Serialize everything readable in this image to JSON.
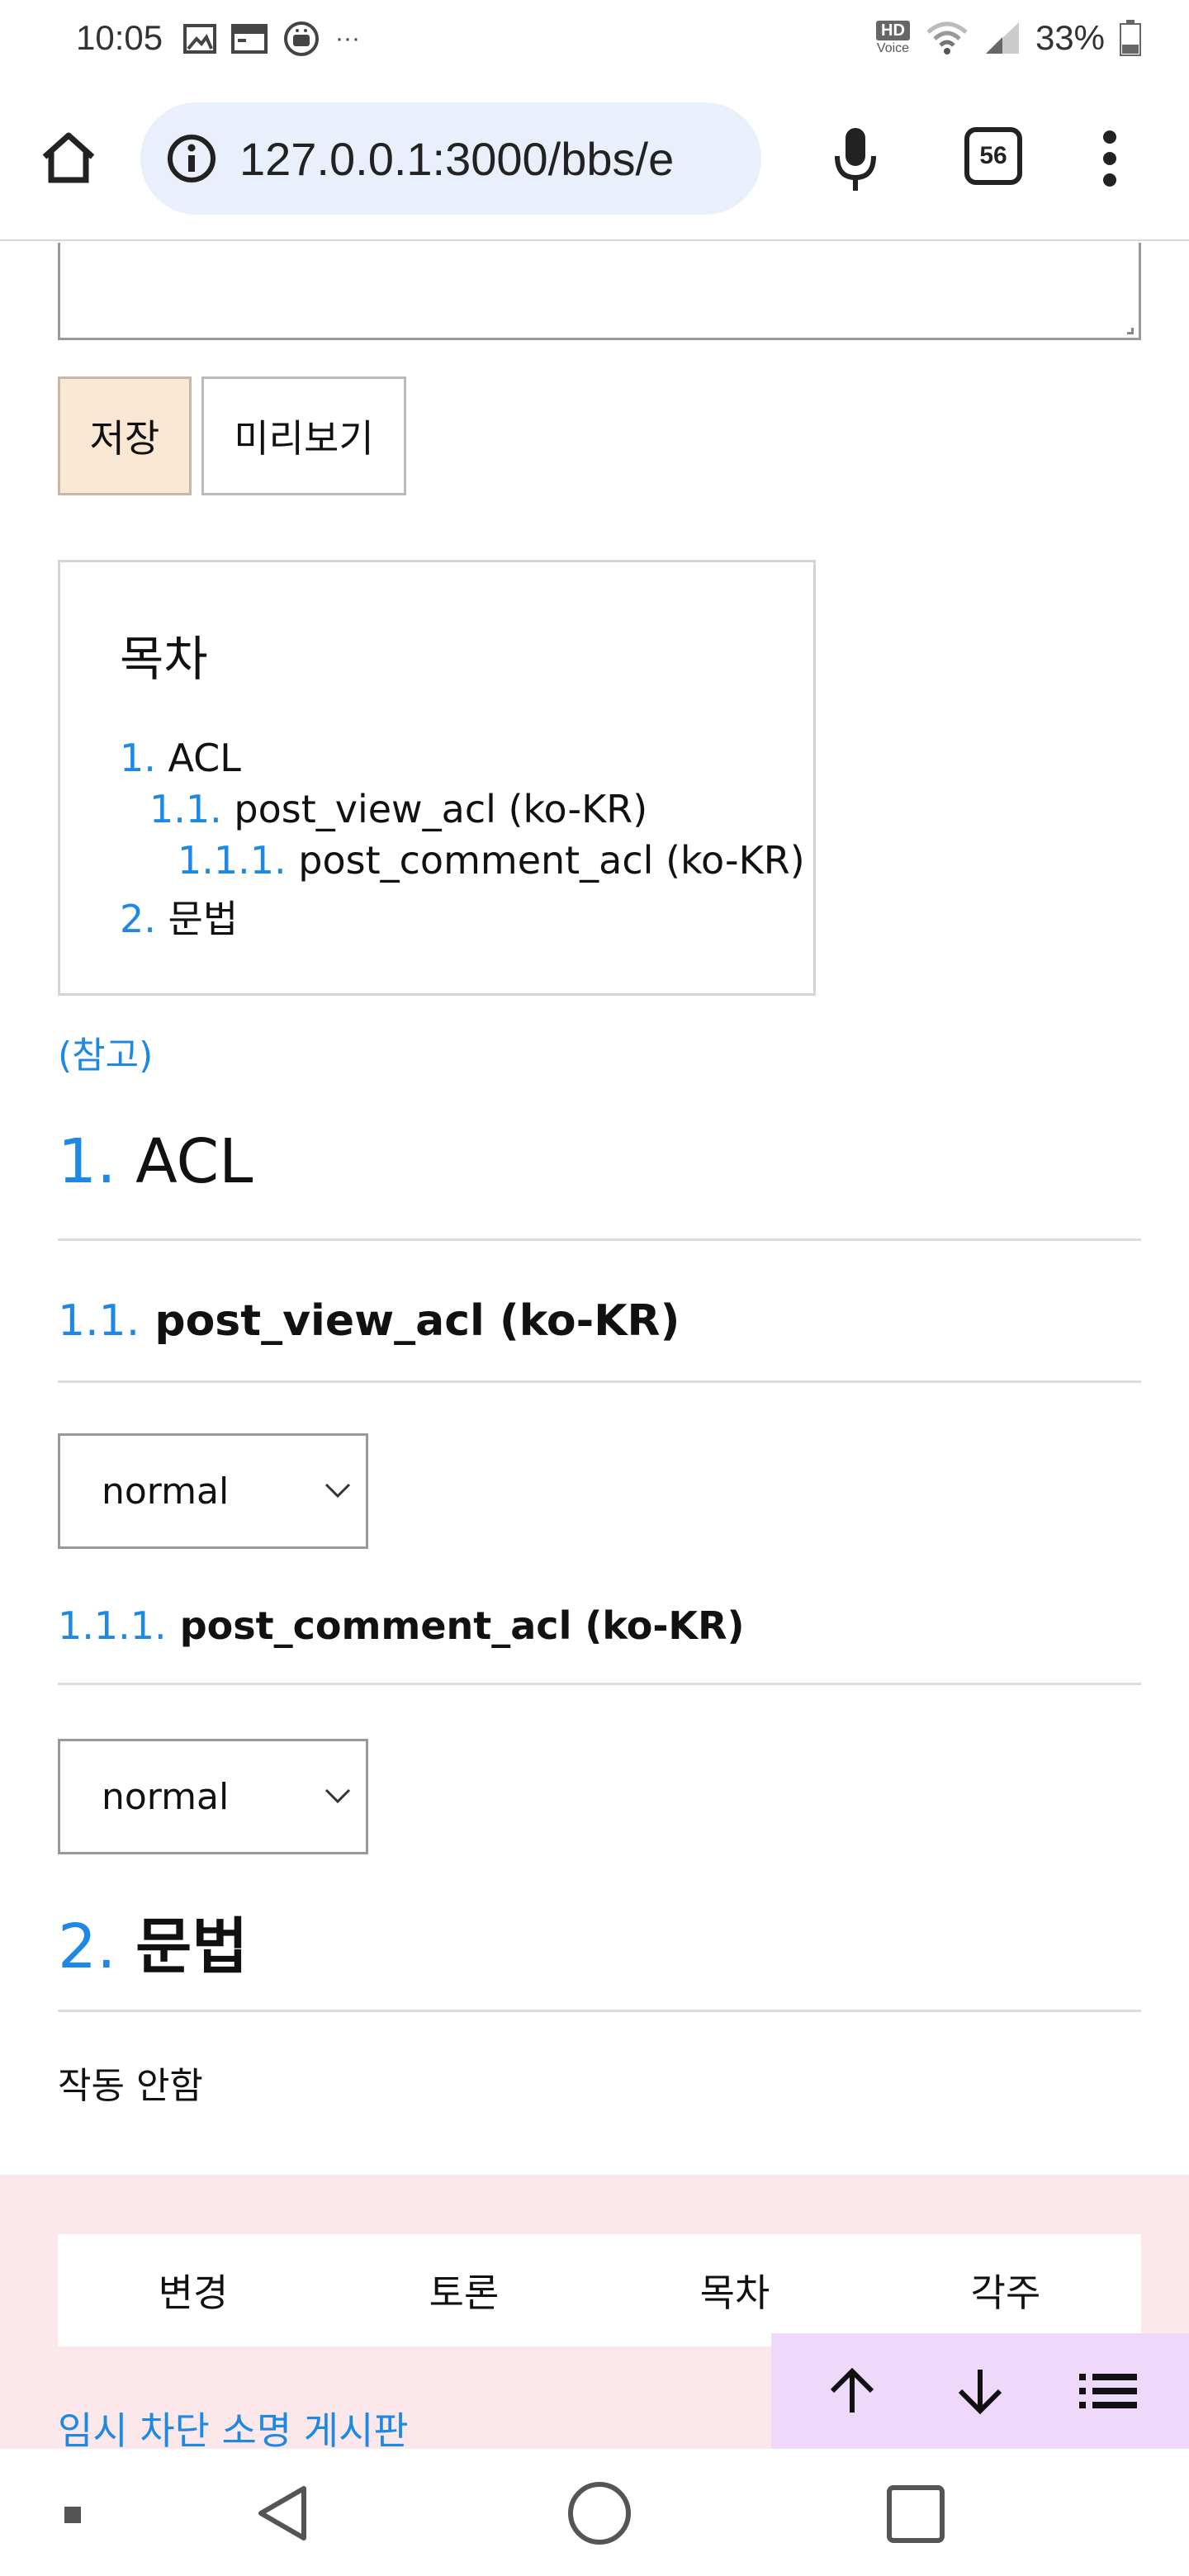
{
  "status_bar": {
    "time": "10:05",
    "more": "···",
    "hd_label": "HD",
    "voice_label": "Voice",
    "battery": "33%"
  },
  "toolbar": {
    "url": "127.0.0.1:3000/bbs/e",
    "tab_count": "56"
  },
  "editor": {
    "save_label": "저장",
    "preview_label": "미리보기"
  },
  "toc": {
    "title": "목차",
    "items": [
      {
        "num": "1.",
        "label": "ACL"
      },
      {
        "num": "1.1.",
        "label": "post_view_acl (ko-KR)"
      },
      {
        "num": "1.1.1.",
        "label": "post_comment_acl (ko-KR)"
      },
      {
        "num": "2.",
        "label": "문법"
      }
    ]
  },
  "reference_link": "(참고)",
  "sections": {
    "s1": {
      "num": "1.",
      "title": "ACL"
    },
    "s1_1": {
      "num": "1.1.",
      "title": "post_view_acl (ko-KR)",
      "select_value": "normal"
    },
    "s1_1_1": {
      "num": "1.1.1.",
      "title": "post_comment_acl (ko-KR)",
      "select_value": "normal"
    },
    "s2": {
      "num": "2.",
      "title": "문법",
      "body": "작동 안함"
    }
  },
  "footer": {
    "tabs": [
      "변경",
      "토론",
      "목차",
      "각주"
    ],
    "link": "임시 차단 소명 게시판"
  },
  "colors": {
    "accent": "#1e88e5",
    "save_bg": "#fae8d4",
    "footer_bg": "#fce8ea",
    "float_panel_bg": "#efd9fb",
    "url_bar_bg": "#eaf0fb"
  }
}
